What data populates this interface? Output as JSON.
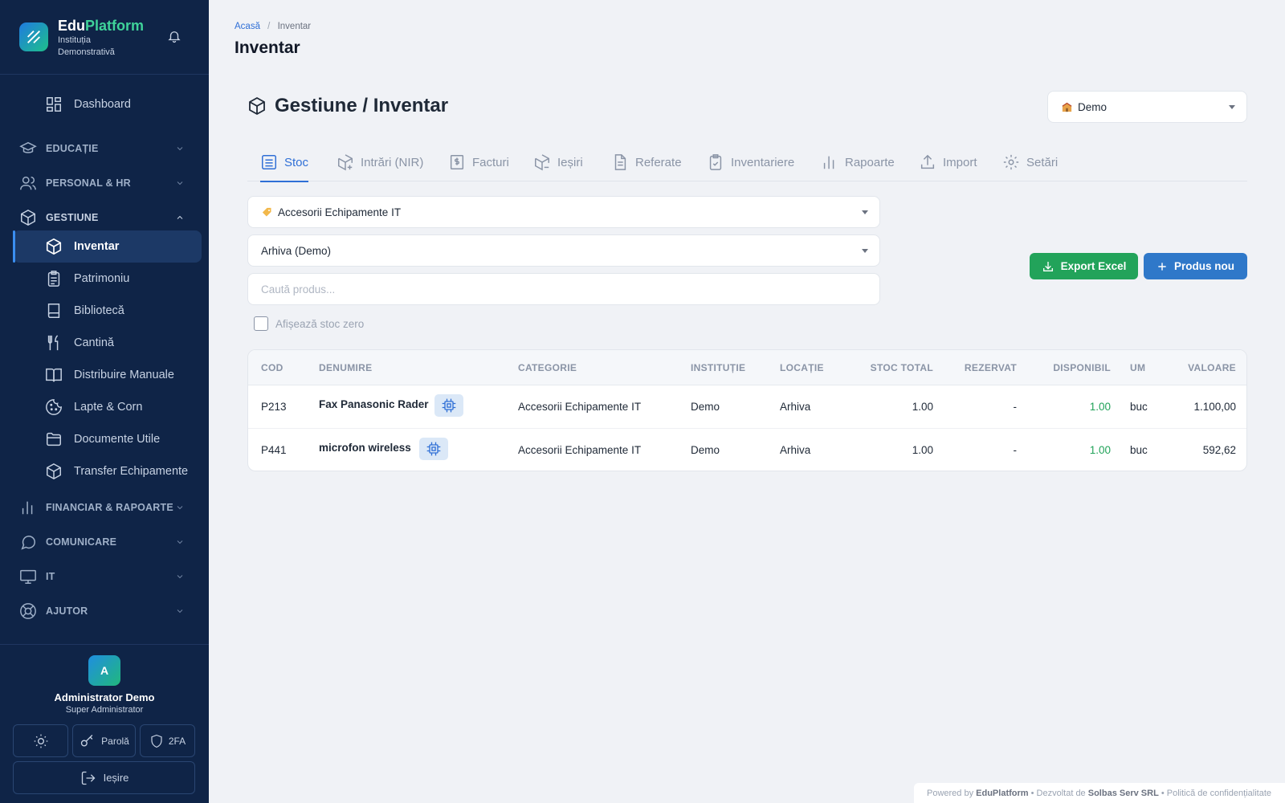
{
  "brand": {
    "name_part1": "Edu",
    "name_part2": "Platform",
    "institution": "Instituția Demonstrativă"
  },
  "sidebar": {
    "dashboard": "Dashboard",
    "sections": {
      "educatie": "EDUCAȚIE",
      "personal": "PERSONAL & HR",
      "gestiune": "GESTIUNE",
      "financiar": "FINANCIAR & RAPOARTE",
      "comunicare": "COMUNICARE",
      "it": "IT",
      "ajutor": "AJUTOR"
    },
    "items": {
      "inventar": "Inventar",
      "patrimoniu": "Patrimoniu",
      "biblioteca": "Bibliotecă",
      "cantina": "Cantină",
      "manuale": "Distribuire Manuale",
      "lapte": "Lapte & Corn",
      "documente": "Documente Utile",
      "transfer": "Transfer Echipamente"
    }
  },
  "user": {
    "initial": "A",
    "name": "Administrator Demo",
    "role": "Super Administrator",
    "password_label": "Parolă",
    "twofa_label": "2FA",
    "logout_label": "Ieșire"
  },
  "header": {
    "breadcrumb_home": "Acasă",
    "breadcrumb_sep": "/",
    "breadcrumb_current": "Inventar",
    "title": "Inventar"
  },
  "content": {
    "section_title": "Gestiune / Inventar",
    "institution_select": "Demo",
    "tabs": [
      "Stoc",
      "Intrări (NIR)",
      "Facturi",
      "Ieșiri",
      "Referate",
      "Inventariere",
      "Rapoarte",
      "Import",
      "Setări"
    ],
    "category_select": "Accesorii Echipamente IT",
    "location_select": "Arhiva (Demo)",
    "search_placeholder": "Caută produs...",
    "show_zero_label": "Afișează stoc zero",
    "export_label": "Export Excel",
    "new_product_label": "Produs nou"
  },
  "table": {
    "headers": [
      "COD",
      "DENUMIRE",
      "CATEGORIE",
      "INSTITUȚIE",
      "LOCAȚIE",
      "STOC TOTAL",
      "REZERVAT",
      "DISPONIBIL",
      "UM",
      "VALOARE"
    ],
    "rows": [
      {
        "cod": "P213",
        "denumire": "Fax Panasonic Rader",
        "categorie": "Accesorii Echipamente IT",
        "institutie": "Demo",
        "locatie": "Arhiva",
        "stoc": "1.00",
        "rezervat": "-",
        "disponibil": "1.00",
        "um": "buc",
        "valoare": "1.100,00"
      },
      {
        "cod": "P441",
        "denumire": "microfon wireless",
        "categorie": "Accesorii Echipamente IT",
        "institutie": "Demo",
        "locatie": "Arhiva",
        "stoc": "1.00",
        "rezervat": "-",
        "disponibil": "1.00",
        "um": "buc",
        "valoare": "592,62"
      }
    ]
  },
  "footer": {
    "powered": "Powered by",
    "brand": "EduPlatform",
    "dev": "• Dezvoltat de",
    "company": "Solbas Serv SRL",
    "privacy": "• Politică de confidențialitate"
  },
  "colors": {
    "sidebar_bg": "#0f2447",
    "accent_blue": "#2f6fd6",
    "accent_green": "#22a35a",
    "brand_green": "#3fd39a"
  },
  "icons": [
    "bell-icon",
    "dashboard-icon",
    "graduation-cap-icon",
    "users-icon",
    "box-icon",
    "clipboard-icon",
    "book-icon",
    "utensils-icon",
    "open-book-icon",
    "cookie-icon",
    "folder-icon",
    "transfer-box-icon",
    "chart-icon",
    "chat-icon",
    "monitor-icon",
    "lifebuoy-icon",
    "sun-icon",
    "key-icon",
    "shield-icon",
    "logout-icon",
    "chip-icon",
    "download-icon",
    "plus-icon"
  ]
}
